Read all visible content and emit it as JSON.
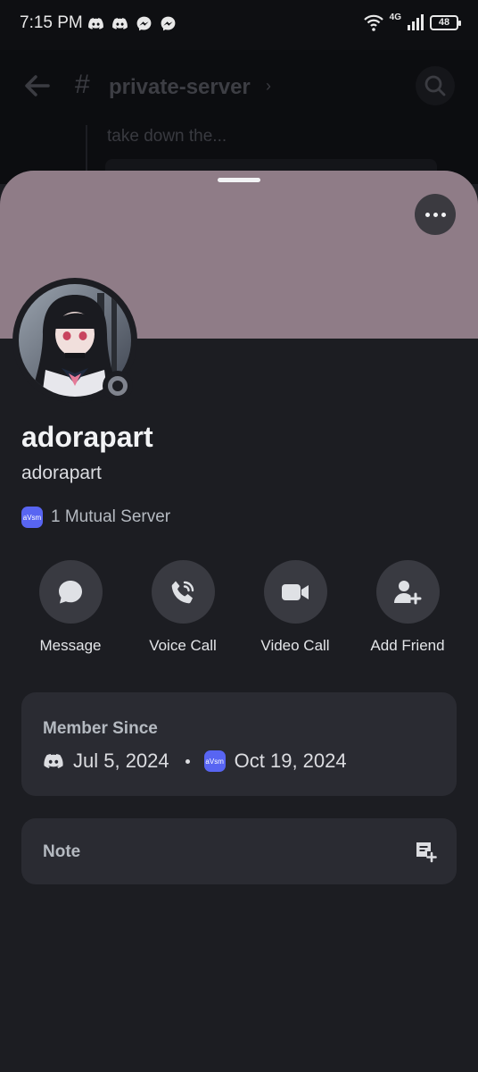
{
  "status_bar": {
    "time": "7:15 PM",
    "network": "4G",
    "battery": "48",
    "app_icons": [
      "discord-icon",
      "discord-icon",
      "messenger-icon",
      "messenger-icon"
    ]
  },
  "channel_header": {
    "hash": "#",
    "name": "private-server",
    "chevron": "›",
    "preview_text": "take down the..."
  },
  "profile": {
    "display_name": "adorapart",
    "username": "adorapart",
    "banner_color": "#8f7c87",
    "status": "offline",
    "mutual_server_badge": "aVsm",
    "mutual_servers": "1 Mutual Server"
  },
  "actions": [
    {
      "label": "Message",
      "icon": "chat-bubble-icon"
    },
    {
      "label": "Voice Call",
      "icon": "phone-icon"
    },
    {
      "label": "Video Call",
      "icon": "video-camera-icon"
    },
    {
      "label": "Add Friend",
      "icon": "add-friend-icon"
    }
  ],
  "member_since": {
    "title": "Member Since",
    "discord_date": "Jul 5, 2024",
    "server_badge": "aVsm",
    "server_date": "Oct 19, 2024"
  },
  "note": {
    "title": "Note"
  },
  "colors": {
    "background": "#1c1d22",
    "card": "#2a2b32",
    "action_button": "#393a41",
    "blurple": "#5865f2"
  }
}
